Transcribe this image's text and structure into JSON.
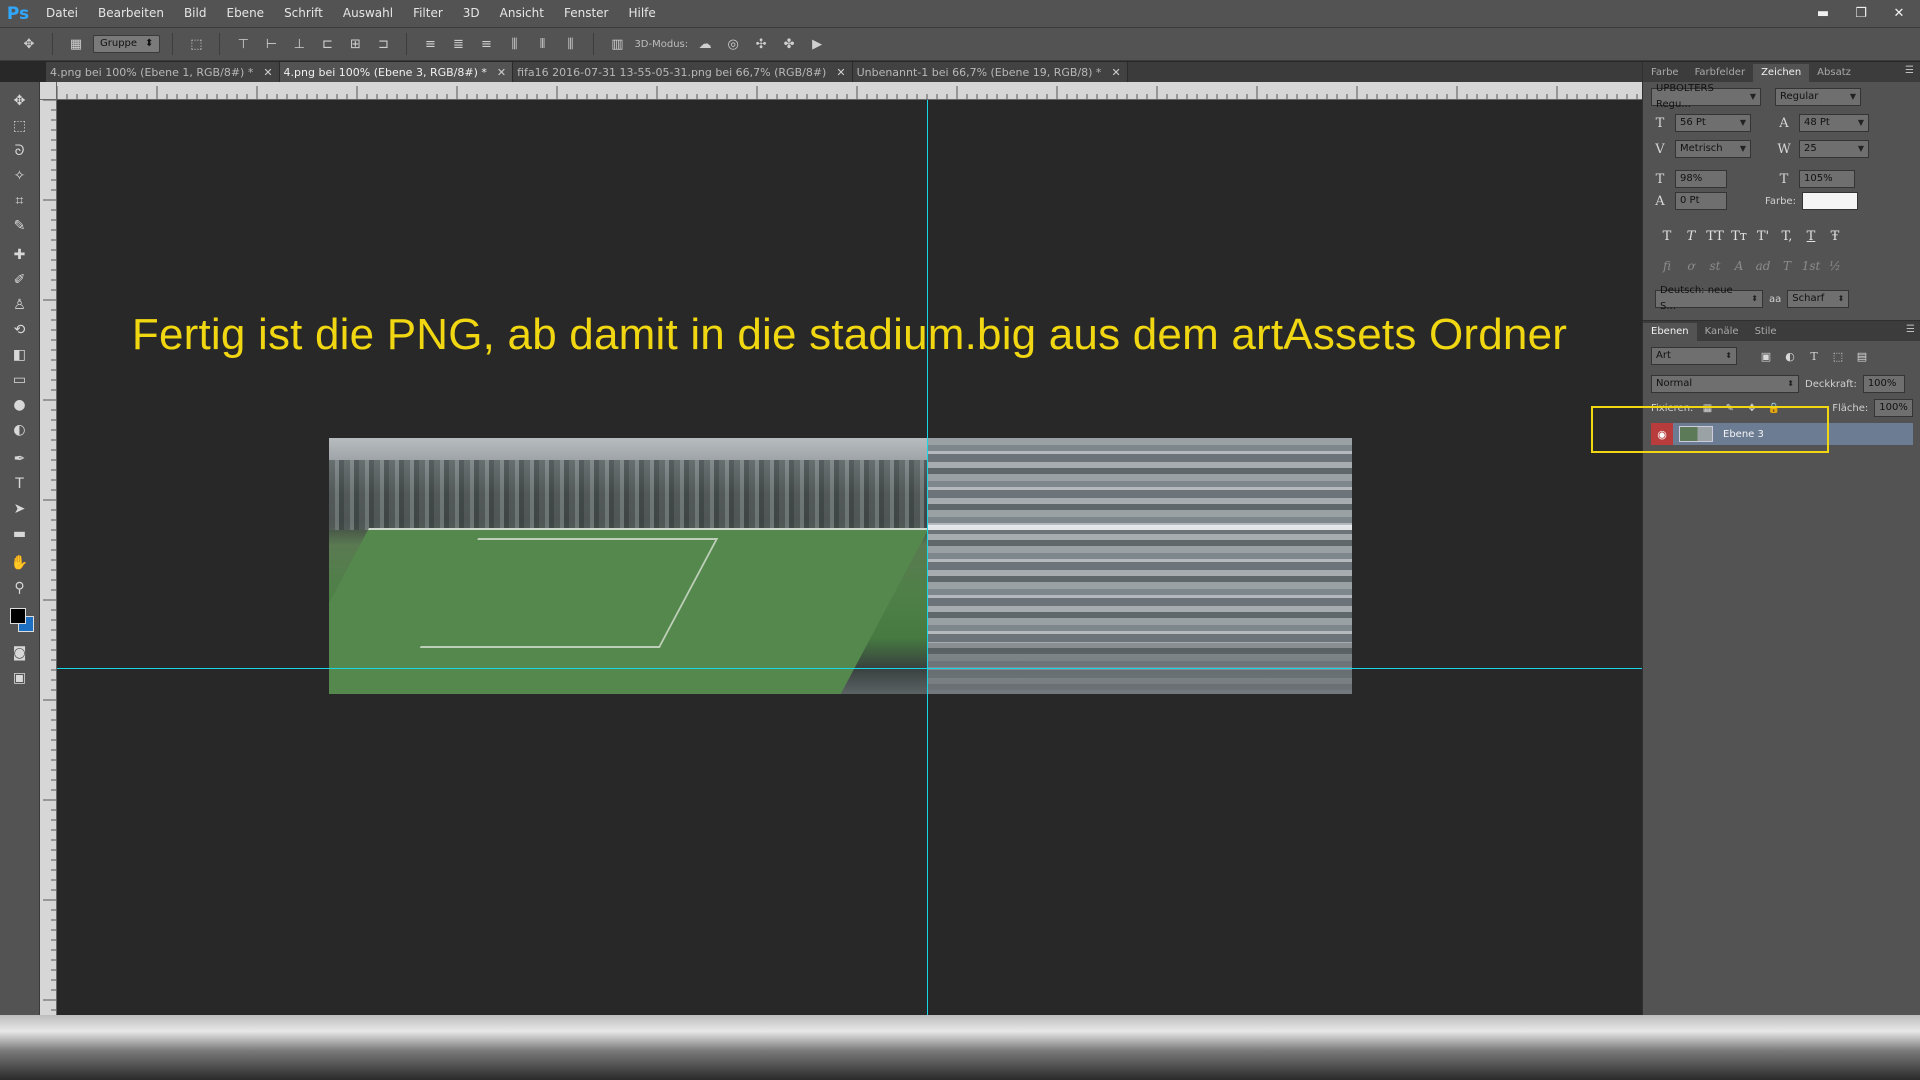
{
  "app": {
    "logo": "Ps"
  },
  "menu": [
    "Datei",
    "Bearbeiten",
    "Bild",
    "Ebene",
    "Schrift",
    "Auswahl",
    "Filter",
    "3D",
    "Ansicht",
    "Fenster",
    "Hilfe"
  ],
  "window": {
    "minimize": "▬",
    "restore": "❐",
    "close": "✕"
  },
  "options": {
    "auto_select": "Gruppe",
    "mode_label": "3D-Modus:"
  },
  "tabs": [
    {
      "label": "4.png bei 100% (Ebene 1, RGB/8#) *",
      "active": false
    },
    {
      "label": "4.png bei 100% (Ebene 3, RGB/8#) *",
      "active": true
    },
    {
      "label": "fifa16 2016-07-31 13-55-05-31.png bei 66,7% (RGB/8#)",
      "active": false
    },
    {
      "label": "Unbenannt-1 bei 66,7% (Ebene 19, RGB/8) *",
      "active": false
    }
  ],
  "canvas": {
    "headline": "Fertig ist die PNG, ab damit in die stadium.big aus dem artAssets Ordner",
    "headline_color": "#f1d711",
    "guide_color": "#19d6e6"
  },
  "character_panel": {
    "tabs": [
      "Farbe",
      "Farbfelder",
      "Zeichen",
      "Absatz"
    ],
    "active_tab": "Zeichen",
    "font_family": "UPBOLTERS Regu...",
    "font_style": "Regular",
    "font_size": "56 Pt",
    "leading": "48 Pt",
    "kerning": "Metrisch",
    "tracking": "25",
    "vertical_scale": "98%",
    "horizontal_scale": "105%",
    "baseline_shift": "0 Pt",
    "color_label": "Farbe:",
    "language": "Deutsch: neue S...",
    "aa_label": "aa",
    "antialias": "Scharf",
    "type_buttons": [
      "T",
      "T",
      "TT",
      "Tт",
      "T'",
      "T,",
      "T",
      "Ŧ"
    ],
    "opentype_buttons": [
      "fi",
      "ơ",
      "st",
      "A",
      "ad",
      "T",
      "1st",
      "½"
    ]
  },
  "layers_panel": {
    "tabs": [
      "Ebenen",
      "Kanäle",
      "Stile"
    ],
    "active_tab": "Ebenen",
    "filter_kind": "Art",
    "blend_mode": "Normal",
    "opacity_label": "Deckkraft:",
    "opacity": "100%",
    "lock_label": "Fixieren:",
    "fill_label": "Fläche:",
    "fill": "100%",
    "layers": [
      {
        "name": "Ebene 3",
        "visible": true,
        "selected": true
      }
    ]
  },
  "highlight_color": "#f1d711"
}
